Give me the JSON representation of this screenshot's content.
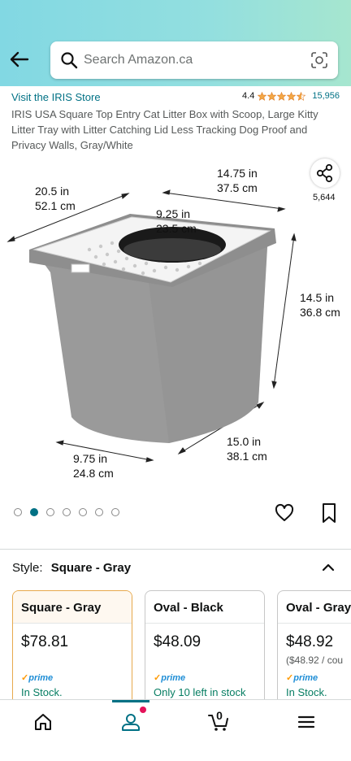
{
  "header": {
    "search_placeholder": "Search Amazon.ca",
    "icons": [
      "back-arrow-icon",
      "search-icon",
      "camera-lens-icon"
    ]
  },
  "store": {
    "link_text": "Visit the IRIS Store",
    "rating": "4.4",
    "stars": 4.5,
    "rating_count": "15,956"
  },
  "product": {
    "title": "IRIS USA Square Top Entry Cat Litter Box with Scoop, Large Kitty Litter Tray with Litter Catching Lid Less Tracking Dog Proof and Privacy Walls, Gray/White",
    "share_count": "5,644",
    "dimensions": {
      "depth_top": [
        "20.5 in",
        "52.1 cm"
      ],
      "width_top": [
        "14.75 in",
        "37.5 cm"
      ],
      "opening": [
        "9.25 in",
        "23.5 cm"
      ],
      "height": [
        "14.5 in",
        "36.8 cm"
      ],
      "bottom_width": [
        "9.75 in",
        "24.8 cm"
      ],
      "bottom_depth": [
        "15.0 in",
        "38.1 cm"
      ]
    },
    "image_count": 7,
    "active_image": 1
  },
  "style_selector": {
    "label": "Style:",
    "value": "Square - Gray",
    "options": [
      {
        "name": "Square - Gray",
        "price": "$78.81",
        "unit_price": "",
        "prime": "prime",
        "stock": "In Stock.",
        "selected": true
      },
      {
        "name": "Oval - Black",
        "price": "$48.09",
        "unit_price": "",
        "prime": "prime",
        "stock": "Only 10 left in stock",
        "selected": false
      },
      {
        "name": "Oval - Gray",
        "price": "$48.92",
        "unit_price": "($48.92 / cou",
        "prime": "prime",
        "stock": "In Stock.",
        "selected": false
      }
    ]
  },
  "bottom_nav": {
    "items": [
      "home-icon",
      "account-icon",
      "cart-icon",
      "menu-icon"
    ],
    "cart_count": "0",
    "active_index": 1
  },
  "colors": {
    "link": "#007185",
    "in_stock": "#067d62",
    "star": "#f3a847",
    "selected_border": "#e7a94d"
  }
}
